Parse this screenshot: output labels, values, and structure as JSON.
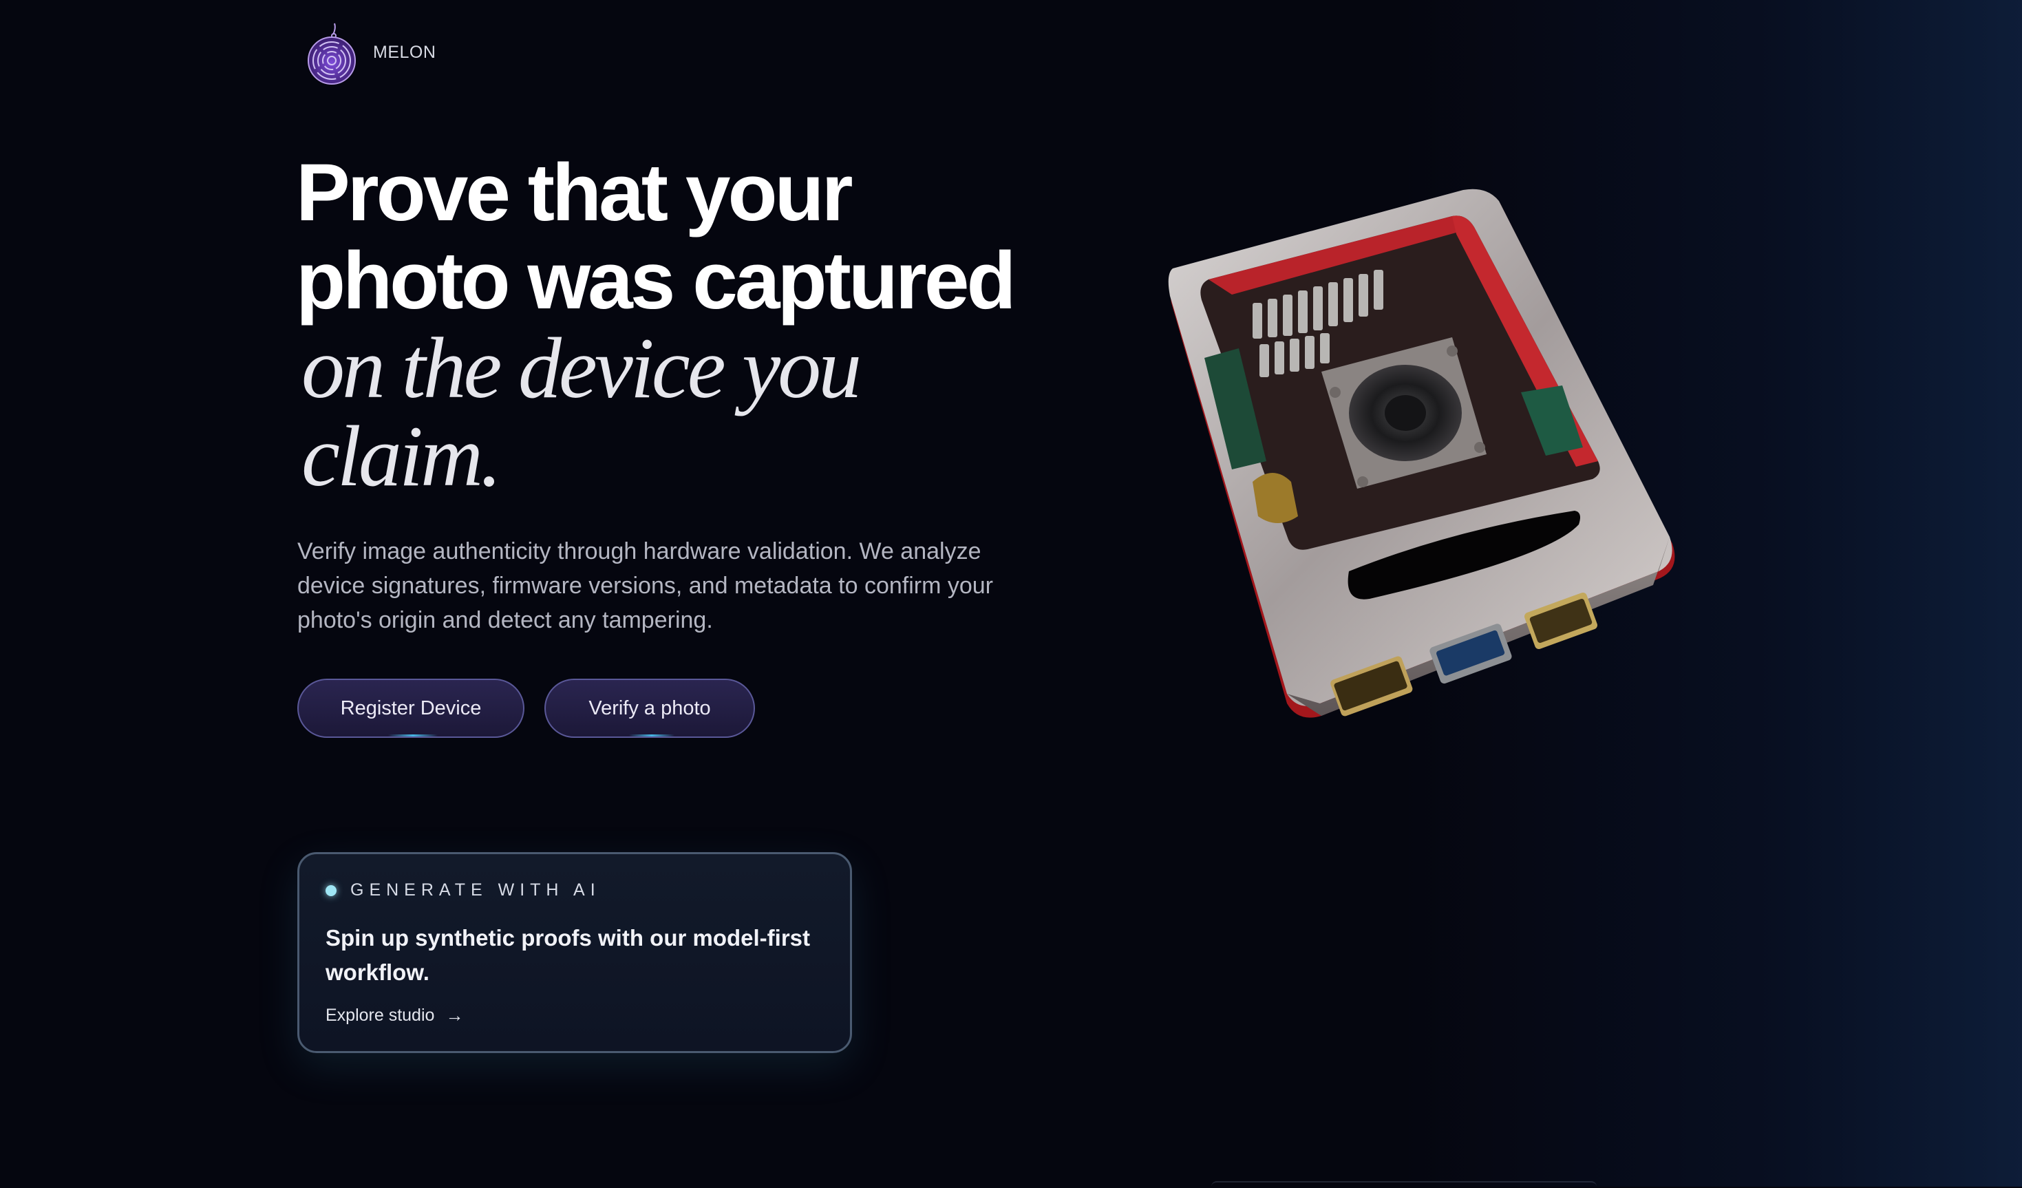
{
  "brand": {
    "name": "MELON",
    "logo_icon": "maze-melon-icon"
  },
  "hero": {
    "line1": "Prove that your",
    "line2": "photo was captured",
    "line3": "on the device you",
    "line4": "claim.",
    "subtitle": "Verify image authenticity through hardware validation. We analyze device signatures, firmware versions, and metadata to confirm your photo's origin and detect any tampering."
  },
  "buttons": {
    "register": "Register Device",
    "verify": "Verify a photo"
  },
  "ai_card": {
    "eyebrow": "GENERATE WITH AI",
    "title": "Spin up synthetic proofs with our model-first workflow.",
    "link": "Explore studio",
    "link_icon": "arrow-right-icon"
  },
  "device_image": {
    "icon": "raspberry-pi-case-3d-model"
  },
  "colors": {
    "background": "#05060f",
    "button_fill": "#231f45",
    "button_border": "#5a5898",
    "accent_dot": "#9fe6f5",
    "card_border": "#4a5a70",
    "device_red": "#b01e23"
  }
}
